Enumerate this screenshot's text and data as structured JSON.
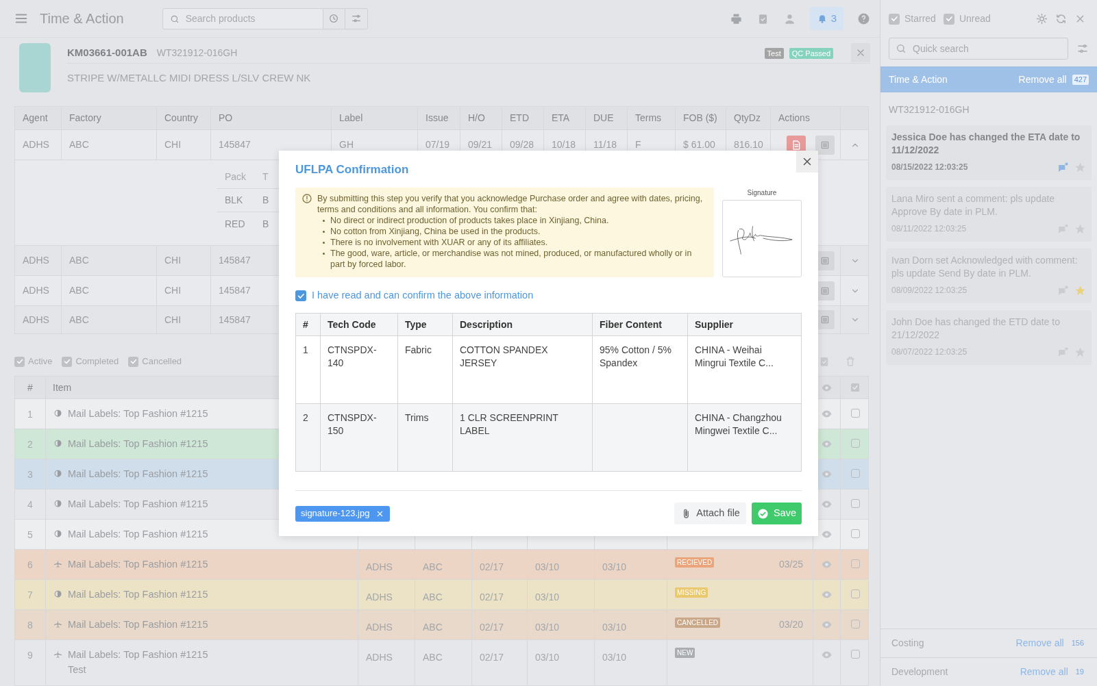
{
  "top_bar": {
    "title": "Time & Action",
    "search": {
      "placeholder": "Search products"
    },
    "notifications": {
      "count": "3"
    }
  },
  "product": {
    "code": "KM03661-001AB",
    "reference": "WT321912-016GH",
    "description": "STRIPE W/METALLC MIDI DRESS L/SLV CREW NK",
    "tags": [
      {
        "label": "Test",
        "color": "#a3a3a3"
      },
      {
        "label": "QC Passed",
        "color": "#86d3bd"
      }
    ]
  },
  "po_table": {
    "columns": [
      "Agent",
      "Factory",
      "Country",
      "PO",
      "Label",
      "Issue",
      "H/O",
      "ETD",
      "ETA",
      "DUE",
      "Terms",
      "FOB ($)",
      "QtyDz",
      "Actions"
    ],
    "rows": [
      {
        "cells": [
          "ADHS",
          "ABC",
          "CHI",
          "145847",
          "GH",
          "07/19",
          "09/21",
          "09/28",
          "10/18",
          "11/18",
          "F",
          "$ 61.00",
          "816.10"
        ],
        "expanded": true,
        "sub_table": {
          "columns": [
            "Pack",
            "T"
          ],
          "rows": [
            [
              "BLK",
              "B"
            ],
            [
              "RED",
              "B"
            ]
          ]
        }
      },
      {
        "cells": [
          "ADHS",
          "ABC",
          "CHI",
          "145847"
        ],
        "expanded": false
      },
      {
        "cells": [
          "ADHS",
          "ABC",
          "CHI",
          "145847"
        ],
        "expanded": false
      },
      {
        "cells": [
          "ADHS",
          "ABC",
          "CHI",
          "145847"
        ],
        "expanded": false
      }
    ]
  },
  "filters": [
    {
      "label": "Active",
      "checked": true
    },
    {
      "label": "Completed",
      "checked": true
    },
    {
      "label": "Cancelled",
      "checked": true
    }
  ],
  "items_table": {
    "columns": [
      "#",
      "Item"
    ],
    "rows": [
      {
        "number": "1",
        "kind": "half-circle",
        "title": "Mail Labels: Top Fashion #1215",
        "color": "#eceef0",
        "checked": false
      },
      {
        "number": "2",
        "kind": "half-circle",
        "title": "Mail Labels: Top Fashion #1215",
        "color": "#cfe7d7",
        "checked": false
      },
      {
        "number": "3",
        "kind": "half-circle",
        "title": "Mail Labels: Top Fashion #1215",
        "color": "#cfdeea",
        "checked": false
      },
      {
        "number": "4",
        "kind": "half-circle",
        "title": "Mail Labels: Top Fashion #1215",
        "color": "#e6e7ea",
        "checked": false
      },
      {
        "number": "5",
        "kind": "half-circle",
        "title": "Mail Labels: Top Fashion #1215",
        "color": "#eceef0",
        "checked": false
      },
      {
        "number": "6",
        "kind": "plane",
        "title": "Mail Labels: Top Fashion #1215",
        "color": "#ecd5c4",
        "checked": false,
        "column_3": "ADHS",
        "column_4": "ABC",
        "column_5": "02/17",
        "column_6": "03/10",
        "column_7": "03/10",
        "status": {
          "label": "RECIEVED",
          "color": "#eba57d"
        },
        "date": "03/25"
      },
      {
        "number": "7",
        "kind": "half-circle",
        "title": "Mail Labels: Top Fashion #1215",
        "color": "#ece3c6",
        "checked": false,
        "column_3": "ADHS",
        "column_4": "ABC",
        "column_5": "02/17",
        "column_6": "03/10",
        "status": {
          "label": "MISSING",
          "color": "#e9c870"
        }
      },
      {
        "number": "8",
        "kind": "plane",
        "title": "Mail Labels: Top Fashion #1215",
        "color": "#e8d9ca",
        "checked": false,
        "column_3": "ADHS",
        "column_4": "ABC",
        "column_5": "02/17",
        "column_6": "03/10",
        "column_7": "03/10",
        "status": {
          "label": "CANCELLED",
          "color": "#c8a888"
        },
        "date": "03/20"
      },
      {
        "number": "9",
        "kind": "plane",
        "title": "Mail Labels: Top Fashion #1215",
        "note": "Test",
        "color": "#e6e7ea",
        "checked": false,
        "column_3": "ADHS",
        "column_4": "ABC",
        "column_5": "02/17",
        "column_6": "03/10",
        "column_7": "03/10",
        "status": {
          "label": "NEW",
          "color": "#a9acb1"
        }
      }
    ]
  },
  "modal": {
    "title": "UFLPA Confirmation",
    "notice": {
      "intro": "By submitting this step you verify that you acknowledge Purchase order and agree with dates, pricing, terms and conditions and all information. You confirm that:",
      "points": [
        "No direct or indirect production of products takes place in Xinjiang, China.",
        "No cotton from Xinjiang, China be used in the products.",
        "There is no involvement with XUAR or any of its affiliates.",
        "The good, ware, article, or merchandise was not mined, produced, or manufactured wholly or in part by forced labor."
      ]
    },
    "signature": {
      "label": "Signature"
    },
    "confirm": {
      "label": "I have read and can confirm the above information",
      "checked": true
    },
    "table": {
      "columns": [
        "#",
        "Tech Code",
        "Type",
        "Description",
        "Fiber Content",
        "Supplier"
      ],
      "rows": [
        [
          "1",
          "CTNSPDX-140",
          "Fabric",
          "COTTON SPANDEX JERSEY",
          "95% Cotton / 5% Spandex",
          "CHINA - Weihai Mingrui Textile C..."
        ],
        [
          "2",
          "CTNSPDX-150",
          "Trims",
          "1 CLR SCREENPRINT LABEL",
          "",
          "CHINA - Changzhou Mingwei Textile C..."
        ]
      ]
    },
    "attachments": [
      {
        "name": "signature-123.jpg"
      }
    ],
    "buttons": [
      {
        "label": "Attach file",
        "kind": "attach"
      },
      {
        "label": "Save",
        "kind": "save"
      }
    ]
  },
  "notifications_panel": {
    "filters": [
      {
        "label": "Starred",
        "checked": true
      },
      {
        "label": "Unread",
        "checked": true
      }
    ],
    "search": {
      "placeholder": "Quick search"
    },
    "groups": [
      {
        "title": "Time & Action",
        "action": "Remove all",
        "count": "427",
        "expanded": true,
        "subtitle": "WT321912-016GH",
        "items": [
          {
            "message": "Jessica Doe has changed the ETA date to 11/12/2022",
            "time": "08/15/2022 12:03:25",
            "unread": true,
            "starred": false
          },
          {
            "message": "Lana Miro sent a comment: pls update Approve By date in PLM.",
            "time": "08/11/2022 12:03:25",
            "unread": false,
            "starred": false
          },
          {
            "message": "Ivan Dorn set Acknowledged with comment: pls update Send By date in PLM.",
            "time": "08/09/2022 12:03:25",
            "unread": false,
            "starred": true
          },
          {
            "message": "John Doe has changed the ETD date to 21/12/2022",
            "time": "08/07/2022 12:03:25",
            "unread": false,
            "starred": false
          }
        ]
      },
      {
        "title": "Costing",
        "action": "Remove all",
        "count": "156",
        "expanded": false
      },
      {
        "title": "Development",
        "action": "Remove all",
        "count": "19",
        "expanded": false
      }
    ]
  }
}
